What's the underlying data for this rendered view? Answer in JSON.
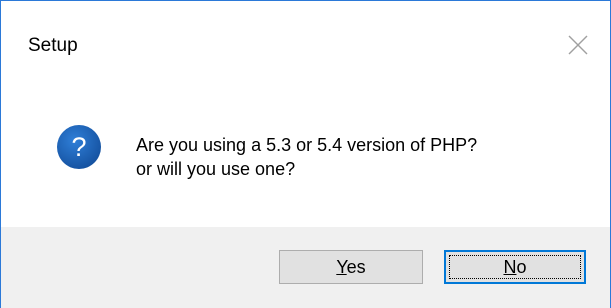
{
  "window": {
    "title": "Setup",
    "close_icon": "close-icon"
  },
  "message": {
    "icon": "question-icon",
    "icon_color": "#1a5fb4",
    "line1": "Are you using a 5.3 or 5.4 version of PHP?",
    "line2": "or will you use one?"
  },
  "buttons": {
    "yes": {
      "mnemonic": "Y",
      "rest": "es"
    },
    "no": {
      "mnemonic": "N",
      "rest": "o"
    }
  },
  "colors": {
    "window_border": "#2b79d8",
    "footer_bg": "#f0f0f0",
    "focus_border": "#0078d7"
  }
}
